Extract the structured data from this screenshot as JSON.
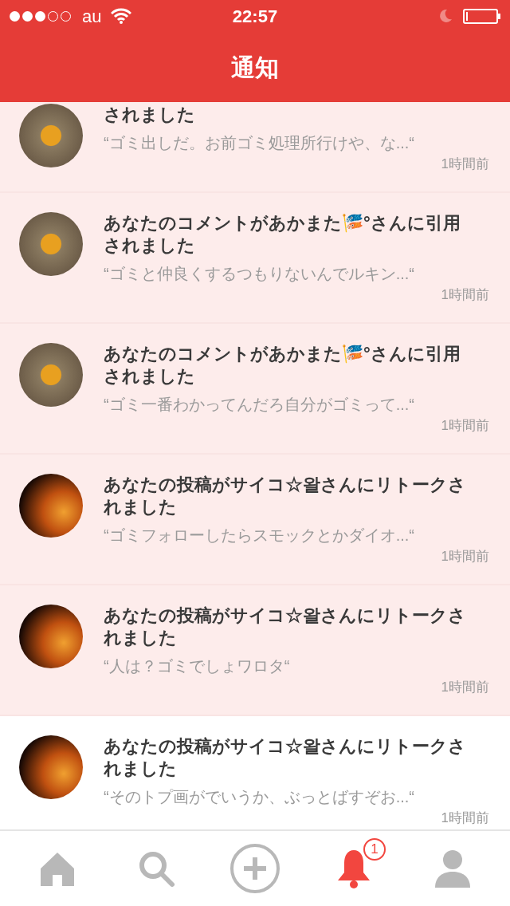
{
  "status_bar": {
    "carrier": "au",
    "time": "22:57"
  },
  "header": {
    "title": "通知"
  },
  "notifications": [
    {
      "kind": "sign",
      "unread": true,
      "title": "されました",
      "quote": "“ゴミ出しだ。お前ゴミ処理所行けや、な...“",
      "time": "1時間前"
    },
    {
      "kind": "sign",
      "unread": true,
      "title": "あなたのコメントがあかまた🎏°さんに引用されました",
      "quote": "“ゴミと仲良くするつもりないんでルキン...“",
      "time": "1時間前"
    },
    {
      "kind": "sign",
      "unread": true,
      "title": "あなたのコメントがあかまた🎏°さんに引用されました",
      "quote": "“ゴミ一番わかってんだろ自分がゴミって...“",
      "time": "1時間前"
    },
    {
      "kind": "flame",
      "unread": true,
      "title": "あなたの投稿がサイコ☆왈さんにリトークされました",
      "quote": "“ゴミフォローしたらスモックとかダイオ...“",
      "time": "1時間前"
    },
    {
      "kind": "flame",
      "unread": true,
      "title": "あなたの投稿がサイコ☆왈さんにリトークされました",
      "quote": "“人は？ゴミでしょワロタ“",
      "time": "1時間前"
    },
    {
      "kind": "flame",
      "unread": false,
      "title": "あなたの投稿がサイコ☆왈さんにリトークされました",
      "quote": "“そのトプ画がでいうか、ぶっとばすぞお...“",
      "time": "1時間前"
    }
  ],
  "tab_bar": [
    {
      "kind": "home",
      "selected": false
    },
    {
      "kind": "search",
      "selected": false
    },
    {
      "kind": "post",
      "selected": false
    },
    {
      "kind": "bell",
      "selected": true,
      "badge": "1"
    },
    {
      "kind": "profile",
      "selected": false
    }
  ]
}
